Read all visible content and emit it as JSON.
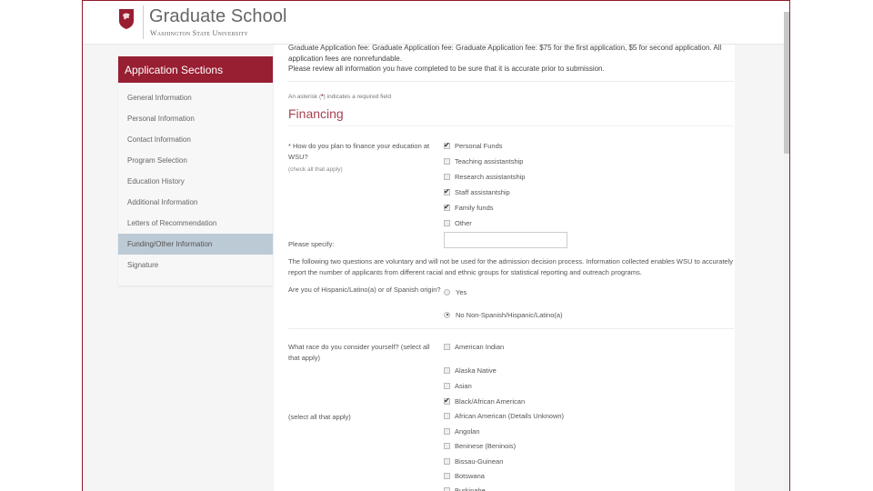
{
  "header": {
    "title": "Graduate School",
    "subtitle": "Washington State University",
    "brand_color": "#981e32"
  },
  "sidebar": {
    "heading": "Application Sections",
    "items": [
      {
        "label": "General Information",
        "active": false
      },
      {
        "label": "Personal Information",
        "active": false
      },
      {
        "label": "Contact Information",
        "active": false
      },
      {
        "label": "Program Selection",
        "active": false
      },
      {
        "label": "Education History",
        "active": false
      },
      {
        "label": "Additional Information",
        "active": false
      },
      {
        "label": "Letters of Recommendation",
        "active": false
      },
      {
        "label": "Funding/Other Information",
        "active": true
      },
      {
        "label": "Signature",
        "active": false
      }
    ]
  },
  "main": {
    "notice_line1": "Graduate Application fee: Graduate Application fee: Graduate Application fee: $75 for the first application, $5 for second application. All application fees are nonrefundable.",
    "notice_line2": "Please review all information you have completed to be sure that it is accurate prior to submission.",
    "required_note_prefix": "An asterisk (",
    "required_note_star": "*",
    "required_note_suffix": ") indicates a required field",
    "section_title": "Financing",
    "finance_question": "* How do you plan to finance your education at WSU?",
    "finance_hint": "(check all that apply)",
    "finance_options": [
      {
        "label": "Personal Funds",
        "checked": true
      },
      {
        "label": "Teaching assistantship",
        "checked": false
      },
      {
        "label": "Research assistantship",
        "checked": false
      },
      {
        "label": "Staff assistantship",
        "checked": true
      },
      {
        "label": "Family funds",
        "checked": true
      },
      {
        "label": "Other",
        "checked": false
      }
    ],
    "specify_label": "Please specify:",
    "specify_value": "",
    "voluntary_text": "The following two questions are voluntary and will not be used for the admission decision process. Information collected enables WSU to accurately report the number of applicants from different racial and ethnic groups for statistical reporting and outreach programs.",
    "hispanic_question": "Are you of Hispanic/Latino(a) or of Spanish origin?",
    "hispanic_options": [
      {
        "label": "Yes",
        "checked": false
      },
      {
        "label": "No Non-Spanish/Hispanic/Latino(a)",
        "checked": true
      }
    ],
    "race_question": "What race do you consider yourself? (select all that apply)",
    "race_hint": "(select all that apply)",
    "race_options_primary": [
      {
        "label": "American Indian",
        "checked": false
      },
      {
        "label": "Alaska Native",
        "checked": false
      },
      {
        "label": "Asian",
        "checked": false
      },
      {
        "label": "Black/African American",
        "checked": true
      }
    ],
    "race_options_sub": [
      {
        "label": "African American (Details Unknown)",
        "checked": false
      },
      {
        "label": "Angolan",
        "checked": false
      },
      {
        "label": "Beninese (Beninois)",
        "checked": false
      },
      {
        "label": "Bissau-Guinean",
        "checked": false
      },
      {
        "label": "Botswana",
        "checked": false
      },
      {
        "label": "Burkinabe",
        "checked": false
      }
    ]
  }
}
